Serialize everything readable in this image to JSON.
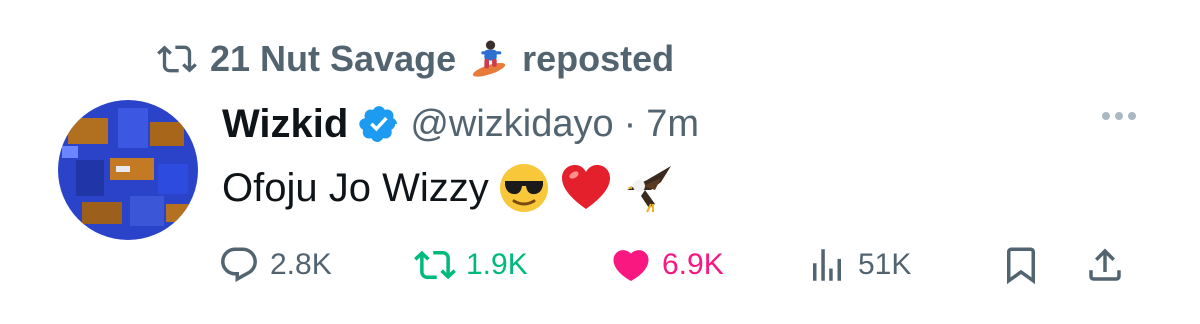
{
  "repost": {
    "user": "21 Nut Savage",
    "label": "reposted"
  },
  "tweet": {
    "name": "Wizkid",
    "handle": "@wizkidayo",
    "separator": "·",
    "time": "7m",
    "text": "Ofoju Jo Wizzy"
  },
  "actions": {
    "replies": "2.8K",
    "reposts": "1.9K",
    "likes": "6.9K",
    "views": "51K"
  },
  "colors": {
    "repost_green": "#00ba7c",
    "like_pink": "#f91880",
    "verified_blue": "#1d9bf0",
    "muted_gray": "#536471"
  }
}
